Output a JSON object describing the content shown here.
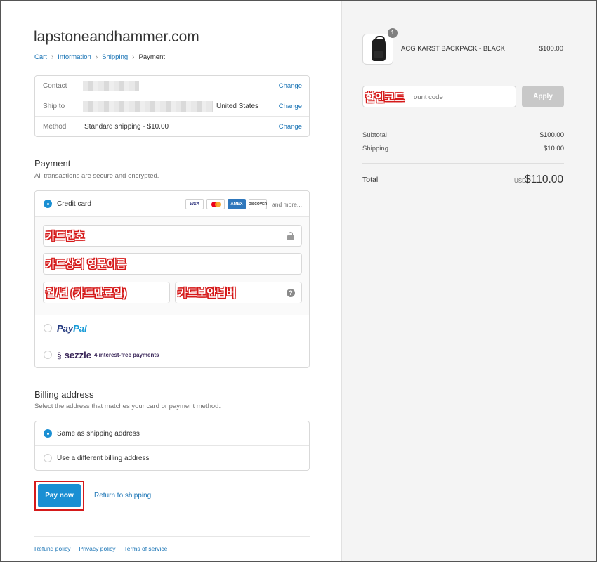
{
  "store": {
    "name": "lapstoneandhammer.com"
  },
  "breadcrumb": [
    {
      "label": "Cart"
    },
    {
      "label": "Information"
    },
    {
      "label": "Shipping"
    },
    {
      "label": "Payment"
    }
  ],
  "review": {
    "contact": {
      "label": "Contact",
      "change": "Change"
    },
    "ship_to": {
      "label": "Ship to",
      "country": "United States",
      "change": "Change"
    },
    "method": {
      "label": "Method",
      "value": "Standard shipping · $10.00",
      "change": "Change"
    }
  },
  "payment": {
    "title": "Payment",
    "subtitle": "All transactions are secure and encrypted.",
    "credit_card": {
      "label": "Credit card",
      "selected": true
    },
    "card_brands": [
      "VISA",
      "AMEX",
      "DISCOVER"
    ],
    "and_more": "and more...",
    "fields": {
      "card_number": "카드번호",
      "name_on_card": "카드상의 영문이름",
      "expiry": "월/년 (카드만료일)",
      "security_code": "카드보안넘버"
    },
    "paypal": {
      "part1": "Pay",
      "part2": "Pal"
    },
    "sezzle": {
      "name": "sezzle",
      "sub": "4 interest-free payments"
    }
  },
  "billing": {
    "title": "Billing address",
    "subtitle": "Select the address that matches your card or payment method.",
    "options": [
      {
        "label": "Same as shipping address",
        "selected": true
      },
      {
        "label": "Use a different billing address",
        "selected": false
      }
    ]
  },
  "actions": {
    "pay_now": "Pay now",
    "return": "Return to shipping"
  },
  "footer": {
    "links": [
      "Refund policy",
      "Privacy policy",
      "Terms of service"
    ]
  },
  "summary": {
    "product": {
      "name": "ACG KARST BACKPACK - BLACK",
      "price": "$100.00",
      "quantity": "1"
    },
    "discount": {
      "annotation": "할인코드",
      "placeholder_visible": "ount code",
      "apply": "Apply"
    },
    "subtotal": {
      "label": "Subtotal",
      "value": "$100.00"
    },
    "shipping": {
      "label": "Shipping",
      "value": "$10.00"
    },
    "total": {
      "label": "Total",
      "currency": "USD",
      "value": "$110.00"
    }
  },
  "colors": {
    "accent": "#1a8fd3",
    "link": "#1a74b5",
    "annotation": "#d51a1a",
    "sidebar_bg": "#f4f4f4"
  }
}
